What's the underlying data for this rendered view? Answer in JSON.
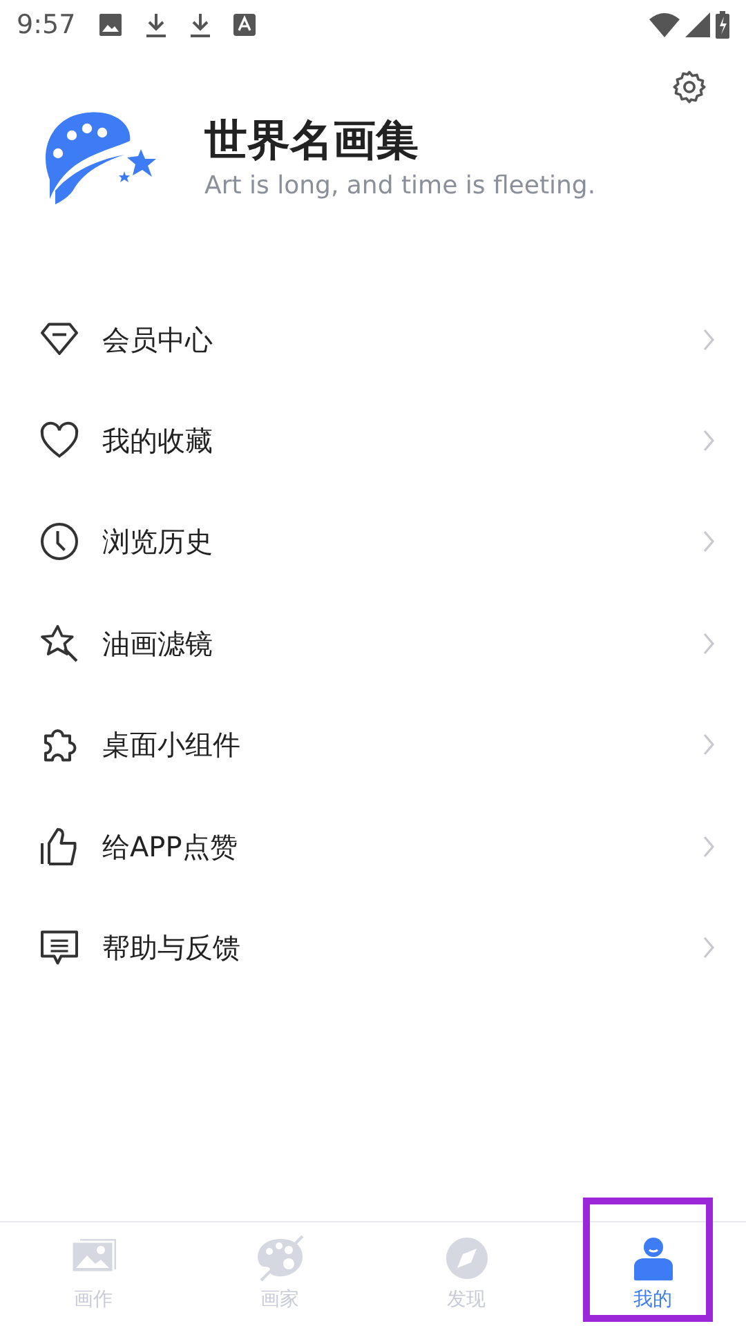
{
  "status_bar": {
    "time": "9:57"
  },
  "profile": {
    "title": "世界名画集",
    "subtitle": "Art is long, and time is fleeting."
  },
  "menu": [
    {
      "kind": "diamond",
      "label": "会员中心"
    },
    {
      "kind": "heart",
      "label": "我的收藏"
    },
    {
      "kind": "clock",
      "label": "浏览历史"
    },
    {
      "kind": "wand",
      "label": "油画滤镜"
    },
    {
      "kind": "puzzle",
      "label": "桌面小组件"
    },
    {
      "kind": "thumb",
      "label": "给APP点赞"
    },
    {
      "kind": "chat",
      "label": "帮助与反馈"
    }
  ],
  "tabs": [
    {
      "kind": "image",
      "label": "画作",
      "selected": false,
      "highlighted": false
    },
    {
      "kind": "palette",
      "label": "画家",
      "selected": false,
      "highlighted": false
    },
    {
      "kind": "compass",
      "label": "发现",
      "selected": false,
      "highlighted": false
    },
    {
      "kind": "person",
      "label": "我的",
      "selected": true,
      "highlighted": true
    }
  ]
}
